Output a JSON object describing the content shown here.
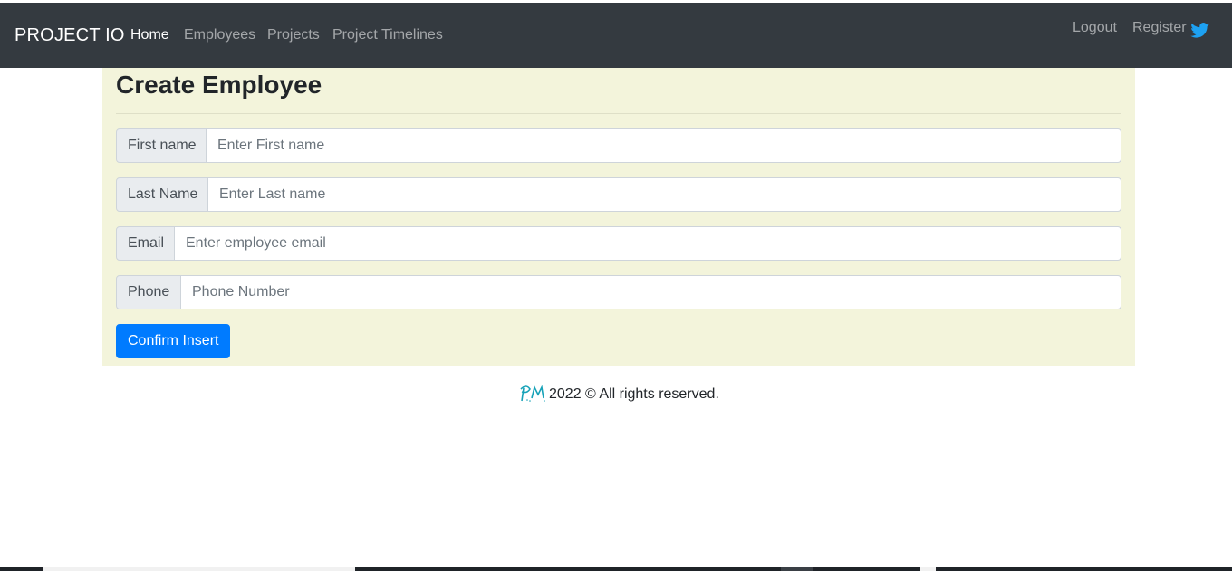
{
  "navbar": {
    "brand": "PROJECT IO",
    "links": [
      {
        "label": "Home",
        "active": true
      },
      {
        "label": "Employees",
        "active": false
      },
      {
        "label": "Projects",
        "active": false
      },
      {
        "label": "Project Timelines",
        "active": false
      }
    ],
    "right": {
      "logout": "Logout",
      "register": "Register",
      "social_icon": "twitter-icon"
    }
  },
  "form": {
    "title": "Create Employee",
    "fields": [
      {
        "label": "First name",
        "placeholder": "Enter First name",
        "value": ""
      },
      {
        "label": "Last Name",
        "placeholder": "Enter Last name",
        "value": ""
      },
      {
        "label": "Email",
        "placeholder": "Enter employee email",
        "value": ""
      },
      {
        "label": "Phone",
        "placeholder": "Phone Number",
        "value": ""
      }
    ],
    "submit_label": "Confirm Insert"
  },
  "footer": {
    "logo_icon": "pm-logo-icon",
    "text": "2022 © All rights reserved."
  },
  "colors": {
    "navbar_bg": "#343a40",
    "panel_bg": "#f3f4db",
    "primary": "#007bff",
    "twitter": "#1da1f2"
  }
}
